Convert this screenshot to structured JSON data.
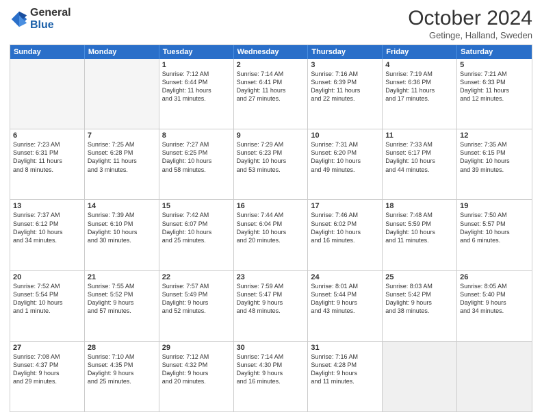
{
  "header": {
    "logo_line1": "General",
    "logo_line2": "Blue",
    "month": "October 2024",
    "location": "Getinge, Halland, Sweden"
  },
  "weekdays": [
    "Sunday",
    "Monday",
    "Tuesday",
    "Wednesday",
    "Thursday",
    "Friday",
    "Saturday"
  ],
  "rows": [
    [
      {
        "day": "",
        "text": "",
        "empty": true
      },
      {
        "day": "",
        "text": "",
        "empty": true
      },
      {
        "day": "1",
        "text": "Sunrise: 7:12 AM\nSunset: 6:44 PM\nDaylight: 11 hours\nand 31 minutes."
      },
      {
        "day": "2",
        "text": "Sunrise: 7:14 AM\nSunset: 6:41 PM\nDaylight: 11 hours\nand 27 minutes."
      },
      {
        "day": "3",
        "text": "Sunrise: 7:16 AM\nSunset: 6:39 PM\nDaylight: 11 hours\nand 22 minutes."
      },
      {
        "day": "4",
        "text": "Sunrise: 7:19 AM\nSunset: 6:36 PM\nDaylight: 11 hours\nand 17 minutes."
      },
      {
        "day": "5",
        "text": "Sunrise: 7:21 AM\nSunset: 6:33 PM\nDaylight: 11 hours\nand 12 minutes."
      }
    ],
    [
      {
        "day": "6",
        "text": "Sunrise: 7:23 AM\nSunset: 6:31 PM\nDaylight: 11 hours\nand 8 minutes."
      },
      {
        "day": "7",
        "text": "Sunrise: 7:25 AM\nSunset: 6:28 PM\nDaylight: 11 hours\nand 3 minutes."
      },
      {
        "day": "8",
        "text": "Sunrise: 7:27 AM\nSunset: 6:25 PM\nDaylight: 10 hours\nand 58 minutes."
      },
      {
        "day": "9",
        "text": "Sunrise: 7:29 AM\nSunset: 6:23 PM\nDaylight: 10 hours\nand 53 minutes."
      },
      {
        "day": "10",
        "text": "Sunrise: 7:31 AM\nSunset: 6:20 PM\nDaylight: 10 hours\nand 49 minutes."
      },
      {
        "day": "11",
        "text": "Sunrise: 7:33 AM\nSunset: 6:17 PM\nDaylight: 10 hours\nand 44 minutes."
      },
      {
        "day": "12",
        "text": "Sunrise: 7:35 AM\nSunset: 6:15 PM\nDaylight: 10 hours\nand 39 minutes."
      }
    ],
    [
      {
        "day": "13",
        "text": "Sunrise: 7:37 AM\nSunset: 6:12 PM\nDaylight: 10 hours\nand 34 minutes."
      },
      {
        "day": "14",
        "text": "Sunrise: 7:39 AM\nSunset: 6:10 PM\nDaylight: 10 hours\nand 30 minutes."
      },
      {
        "day": "15",
        "text": "Sunrise: 7:42 AM\nSunset: 6:07 PM\nDaylight: 10 hours\nand 25 minutes."
      },
      {
        "day": "16",
        "text": "Sunrise: 7:44 AM\nSunset: 6:04 PM\nDaylight: 10 hours\nand 20 minutes."
      },
      {
        "day": "17",
        "text": "Sunrise: 7:46 AM\nSunset: 6:02 PM\nDaylight: 10 hours\nand 16 minutes."
      },
      {
        "day": "18",
        "text": "Sunrise: 7:48 AM\nSunset: 5:59 PM\nDaylight: 10 hours\nand 11 minutes."
      },
      {
        "day": "19",
        "text": "Sunrise: 7:50 AM\nSunset: 5:57 PM\nDaylight: 10 hours\nand 6 minutes."
      }
    ],
    [
      {
        "day": "20",
        "text": "Sunrise: 7:52 AM\nSunset: 5:54 PM\nDaylight: 10 hours\nand 1 minute."
      },
      {
        "day": "21",
        "text": "Sunrise: 7:55 AM\nSunset: 5:52 PM\nDaylight: 9 hours\nand 57 minutes."
      },
      {
        "day": "22",
        "text": "Sunrise: 7:57 AM\nSunset: 5:49 PM\nDaylight: 9 hours\nand 52 minutes."
      },
      {
        "day": "23",
        "text": "Sunrise: 7:59 AM\nSunset: 5:47 PM\nDaylight: 9 hours\nand 48 minutes."
      },
      {
        "day": "24",
        "text": "Sunrise: 8:01 AM\nSunset: 5:44 PM\nDaylight: 9 hours\nand 43 minutes."
      },
      {
        "day": "25",
        "text": "Sunrise: 8:03 AM\nSunset: 5:42 PM\nDaylight: 9 hours\nand 38 minutes."
      },
      {
        "day": "26",
        "text": "Sunrise: 8:05 AM\nSunset: 5:40 PM\nDaylight: 9 hours\nand 34 minutes."
      }
    ],
    [
      {
        "day": "27",
        "text": "Sunrise: 7:08 AM\nSunset: 4:37 PM\nDaylight: 9 hours\nand 29 minutes."
      },
      {
        "day": "28",
        "text": "Sunrise: 7:10 AM\nSunset: 4:35 PM\nDaylight: 9 hours\nand 25 minutes."
      },
      {
        "day": "29",
        "text": "Sunrise: 7:12 AM\nSunset: 4:32 PM\nDaylight: 9 hours\nand 20 minutes."
      },
      {
        "day": "30",
        "text": "Sunrise: 7:14 AM\nSunset: 4:30 PM\nDaylight: 9 hours\nand 16 minutes."
      },
      {
        "day": "31",
        "text": "Sunrise: 7:16 AM\nSunset: 4:28 PM\nDaylight: 9 hours\nand 11 minutes."
      },
      {
        "day": "",
        "text": "",
        "empty": true,
        "shaded": true
      },
      {
        "day": "",
        "text": "",
        "empty": true,
        "shaded": true
      }
    ]
  ]
}
